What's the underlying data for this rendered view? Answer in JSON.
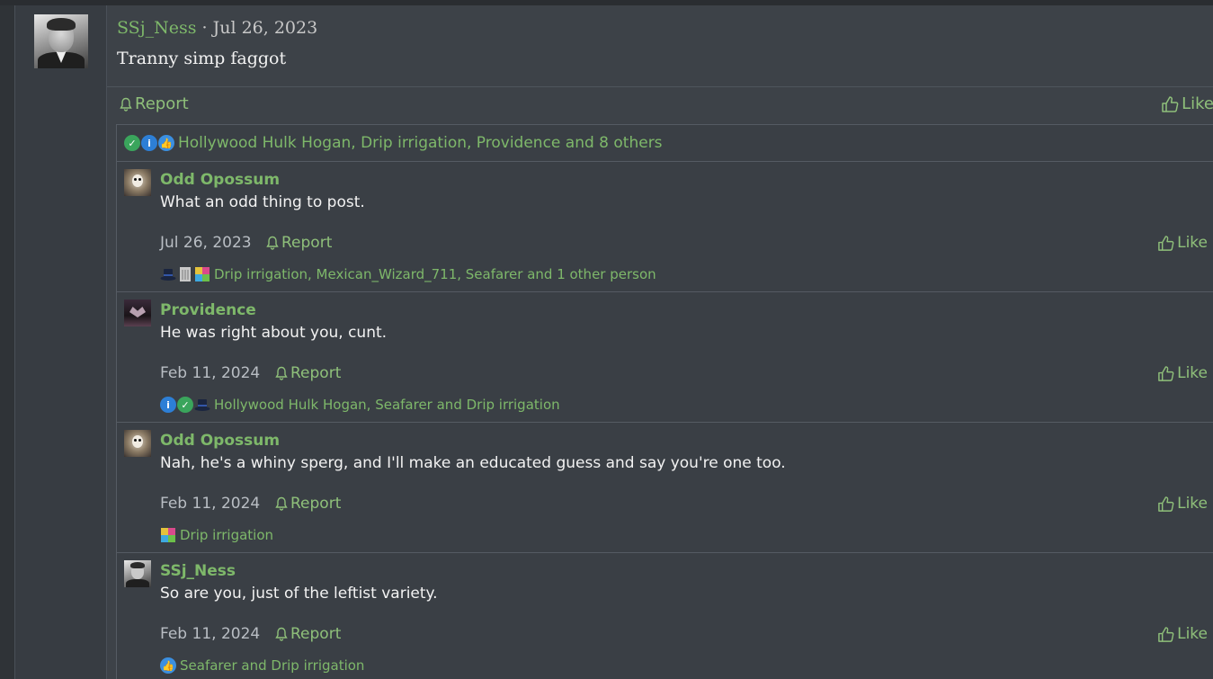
{
  "post": {
    "author": "SSj_Ness",
    "separator": " · ",
    "date": "Jul 26, 2023",
    "body": "Tranny simp faggot",
    "report_label": "Report",
    "like_label": "Like",
    "reactions_text": "Hollywood Hulk Hogan, Drip irrigation, Providence and 8 others",
    "reaction_icons": [
      "check-icon",
      "info-icon",
      "thumbs-up-icon"
    ]
  },
  "comments": [
    {
      "author": "Odd Opossum",
      "text": "What an odd thing to post.",
      "date": "Jul 26, 2023",
      "report_label": "Report",
      "like_label": "Like",
      "reactions_text": "Drip irrigation, Mexican_Wizard_711, Seafarer and 1 other person",
      "reaction_icons": [
        "top-hat-icon",
        "document-icon",
        "puzzle-icon"
      ]
    },
    {
      "author": "Providence",
      "text": "He was right about you, cunt.",
      "date": "Feb 11, 2024",
      "report_label": "Report",
      "like_label": "Like",
      "reactions_text": "Hollywood Hulk Hogan, Seafarer and Drip irrigation",
      "reaction_icons": [
        "info-icon",
        "check-icon",
        "top-hat-icon"
      ]
    },
    {
      "author": "Odd Opossum",
      "text": "Nah, he's a whiny sperg, and I'll make an educated guess and say you're one too.",
      "date": "Feb 11, 2024",
      "report_label": "Report",
      "like_label": "Like",
      "reactions_text": "Drip irrigation",
      "reaction_icons": [
        "puzzle-icon"
      ]
    },
    {
      "author": "SSj_Ness",
      "text": "So are you, just of the leftist variety.",
      "date": "Feb 11, 2024",
      "report_label": "Report",
      "like_label": "Like",
      "reactions_text": "Seafarer and Drip irrigation",
      "reaction_icons": [
        "thumbs-up-icon"
      ]
    }
  ],
  "colors": {
    "accent": "#7eb86a",
    "background": "#3d4248",
    "text": "#f2f2f2"
  }
}
